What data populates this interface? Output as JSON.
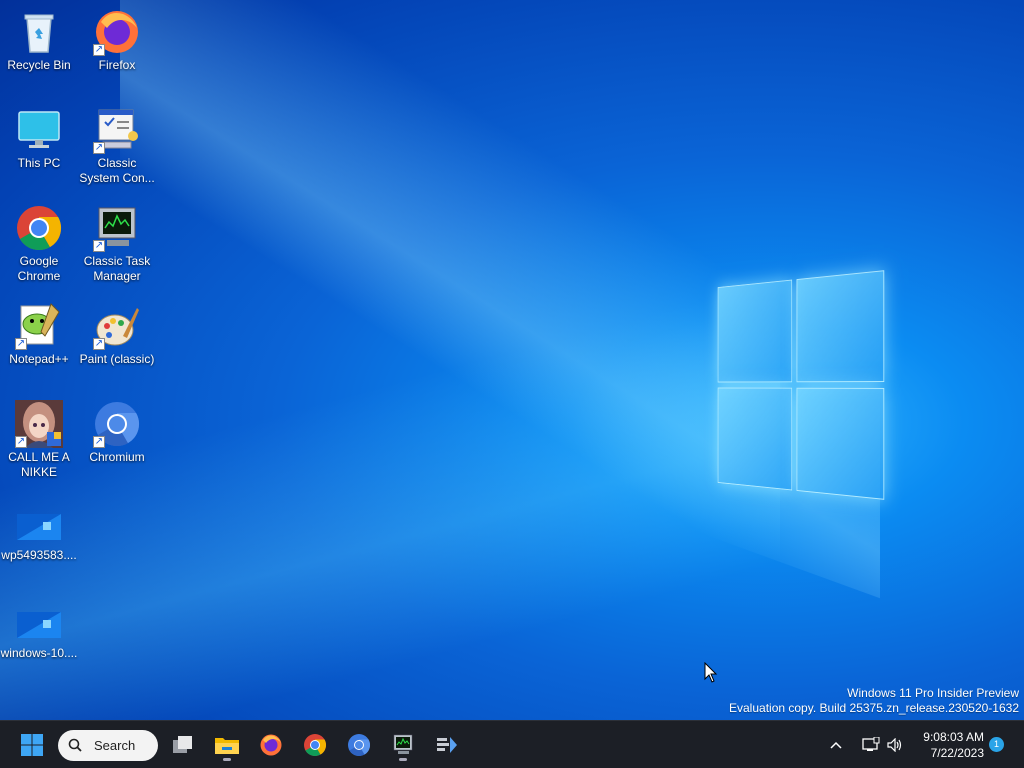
{
  "desktop": {
    "icons": [
      {
        "label": "Recycle Bin",
        "icon": "recycle-bin-icon"
      },
      {
        "label": "Firefox",
        "icon": "firefox-icon"
      },
      {
        "label": "This PC",
        "icon": "monitor-icon"
      },
      {
        "label": "Classic System Con...",
        "icon": "control-panel-icon"
      },
      {
        "label": "Google Chrome",
        "icon": "chrome-icon"
      },
      {
        "label": "Classic Task Manager",
        "icon": "task-manager-icon"
      },
      {
        "label": "Notepad++",
        "icon": "notepadpp-icon"
      },
      {
        "label": "Paint (classic)",
        "icon": "paint-icon"
      },
      {
        "label": "CALL ME A NIKKE",
        "icon": "nikke-icon"
      },
      {
        "label": "Chromium",
        "icon": "chromium-icon"
      },
      {
        "label": "wp5493583....",
        "icon": "image-file-icon"
      },
      {
        "label": "windows-10....",
        "icon": "image-file-icon"
      }
    ]
  },
  "watermark": {
    "line1": "Windows 11 Pro Insider Preview",
    "line2": "Evaluation copy. Build 25375.zn_release.230520-1632"
  },
  "taskbar": {
    "search_label": "Search",
    "apps": [
      "start-icon",
      "task-view-icon",
      "file-explorer-icon",
      "firefox-icon",
      "chrome-icon",
      "chromium-icon",
      "task-manager-icon",
      "widgets-icon"
    ],
    "tray": {
      "time": "9:08:03 AM",
      "date": "7/22/2023",
      "notification_count": "1"
    }
  },
  "colors": {
    "taskbar_bg": "#1c1f26",
    "wallpaper_blue": "#0a64d6",
    "accent": "#2aa4e8"
  }
}
